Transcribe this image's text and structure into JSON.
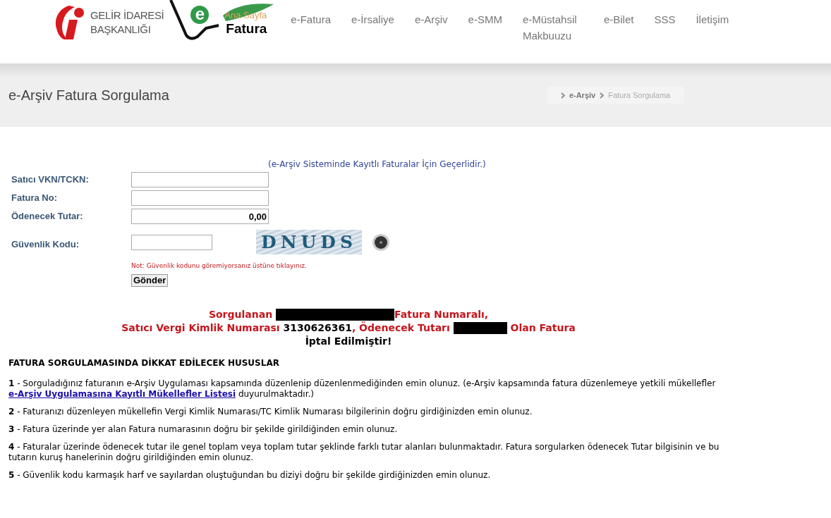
{
  "header": {
    "logo_gib": {
      "line1": "GELİR İDARESİ",
      "line2": "BAŞKANLIĞI"
    },
    "logo_efatura": {
      "letter": "e",
      "overlay": "Ana Sayfa",
      "word": "Fatura"
    },
    "nav": [
      {
        "label": "e-Fatura"
      },
      {
        "label": "e-İrsaliye"
      },
      {
        "label": "e-Arşiv"
      },
      {
        "label": "e-SMM"
      },
      {
        "label": "e-Müstahsil Makbuuzu"
      },
      {
        "label": "e-Bilet"
      },
      {
        "label": "SSS"
      },
      {
        "label": "İletişim"
      }
    ]
  },
  "page_title": "e-Arşiv Fatura Sorgulama",
  "breadcrumb": [
    {
      "label": "e-Arşiv",
      "selected": false
    },
    {
      "label": "Fatura Sorgulama",
      "selected": true
    }
  ],
  "form": {
    "note_top": "(e-Arşiv Sisteminde Kayıtlı Faturalar İçin Geçerlidir.)",
    "fields": [
      {
        "label": "Satıcı VKN/TCKN:"
      },
      {
        "label": "Fatura No:"
      },
      {
        "label": "Ödenecek Tutar:",
        "value": "0,00"
      }
    ],
    "captcha": {
      "label": "Güvenlik Kodu:",
      "code": "DNUDS"
    },
    "hint": "Not: Güvenlik kodunu göremiyorsanız üstüne tıklayınız.",
    "submit": "Gönder"
  },
  "result": [
    [
      {
        "kind": "text",
        "text": "Sorgulanan "
      },
      {
        "kind": "redacted"
      },
      {
        "kind": "text",
        "text": "Fatura Numaralı,"
      }
    ],
    [
      {
        "kind": "text",
        "text": "Satıcı Vergi Kimlik Numarası "
      },
      {
        "kind": "value",
        "text": "3130626361"
      },
      {
        "kind": "text",
        "text": ", Ödenecek Tutarı "
      },
      {
        "kind": "redacted"
      },
      {
        "kind": "text",
        "text": " Olan Fatura"
      }
    ],
    [
      {
        "kind": "value",
        "text": "İptal Edilmiştir!"
      }
    ]
  ],
  "notes": {
    "title": "FATURA SORGULAMASINDA DİKKAT EDİLECEK HUSUSLAR",
    "items": [
      {
        "number": "1",
        "text": " - Sorguladığınız faturanın e-Arşiv Uygulaması kapsamında düzenlenip düzenlenmediğinden emin olunuz. (e-Arşiv kapsamında fatura düzenlemeye yetkili mükellefler ",
        "link": "e-Arşiv Uygulamasına Kayıtlı Mükellefler Listesi",
        "text_after": " duyurulmaktadır.)"
      },
      {
        "number": "2",
        "text": " - Faturanızı düzenleyen mükellefin Vergi Kimlik Numarası/TC Kimlik Numarası bilgilerinin doğru girdiğinizden emin olunuz."
      },
      {
        "number": "3",
        "text": " - Fatura üzerinde yer alan Fatura numarasının doğru bir şekilde girildiğinden emin olunuz."
      },
      {
        "number": "4",
        "text": " - Faturalar üzerinde ödenecek tutar ile genel toplam veya toplam tutar şeklinde farklı tutar alanları bulunmaktadır. Fatura sorgularken ödenecek Tutar bilgisinin ve bu tutarın kuruş hanelerinin doğru girildiğinden emin olunuz."
      },
      {
        "number": "5",
        "text": " - Güvenlik kodu karmaşık harf ve sayılardan oluştuğundan bu diziyi doğru bir şekilde girdiğinizden emin olunuz."
      }
    ]
  }
}
